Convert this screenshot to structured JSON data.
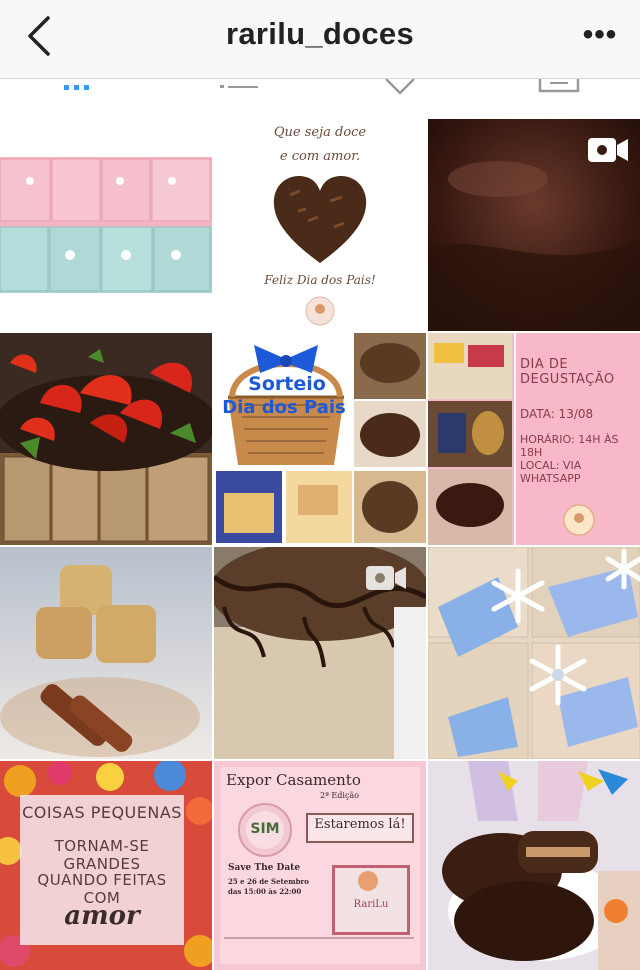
{
  "header": {
    "title": "rarilu_doces",
    "back_icon": "chevron-left-icon",
    "more_label": "•••"
  },
  "tabs": [
    {
      "name": "grid-view",
      "icon": "grid-icon",
      "active": true
    },
    {
      "name": "list-view",
      "icon": "list-icon",
      "active": false
    },
    {
      "name": "tagged",
      "icon": "heart-icon",
      "active": false
    },
    {
      "name": "saved",
      "icon": "bookmark-box-icon",
      "active": false
    }
  ],
  "posts": {
    "p2": {
      "line1": "Que seja doce",
      "line2": "e com amor.",
      "footer": "Feliz Dia dos Pais!"
    },
    "p5": {
      "line1": "Sorteio",
      "line2": "Dia dos Pais"
    },
    "p6": {
      "title": "DIA DE DEGUSTAÇÃO",
      "date": "DATA: 13/08",
      "time": "HORÁRIO: 14H ÀS 18H",
      "local": "LOCAL: VIA WHATSAPP"
    },
    "p10": {
      "l1": "COISAS PEQUENAS",
      "l2": "TORNAM-SE GRANDES",
      "l3": "QUANDO FEITAS COM",
      "l4": "amor"
    },
    "p11": {
      "title": "Expor Casamento",
      "edition": "2ª Edição",
      "badge": "SIM",
      "estaremos": "Estaremos lá!",
      "save": "Save The Date",
      "dates": "25 e 26 de Setembro",
      "hours": "das 15:00 às 22:00",
      "brand": "RariLu"
    }
  },
  "colors": {
    "topbar": "#f8f8f8",
    "active_tab": "#3897f0",
    "inactive_tab": "#999999"
  }
}
